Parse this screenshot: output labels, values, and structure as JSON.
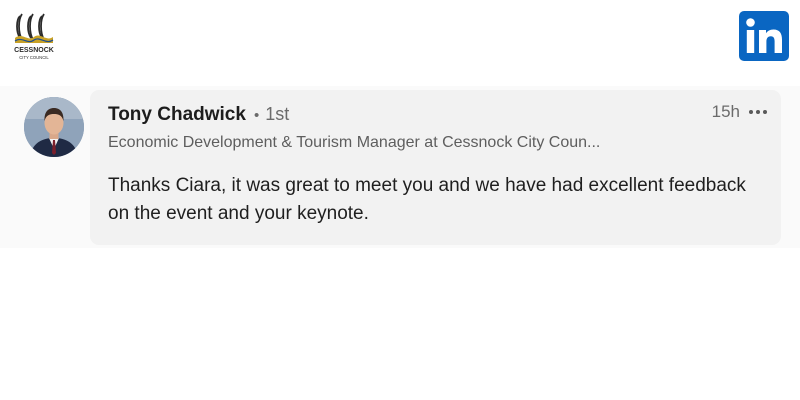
{
  "branding": {
    "council_logo_lines": [
      "CESSNOCK",
      "CITY COUNCIL"
    ],
    "council_logo_icon": "cessnock-wine-glasses-icon",
    "council_logo_colors": {
      "gold": "#c9a227",
      "dark": "#2b2b2b"
    },
    "linkedin_icon": "linkedin-icon",
    "linkedin_label": "in",
    "linkedin_color": "#0a66c2"
  },
  "comment": {
    "author_name": "Tony Chadwick",
    "separator": "•",
    "connection_degree": "1st",
    "headline": "Economic Development & Tourism Manager at Cessnock City Coun...",
    "timestamp": "15h",
    "more_icon": "more-options-icon",
    "text": "Thanks Ciara, it was great to meet you and we have had excellent feedback on the event and your keynote.",
    "avatar_icon": "profile-photo"
  }
}
